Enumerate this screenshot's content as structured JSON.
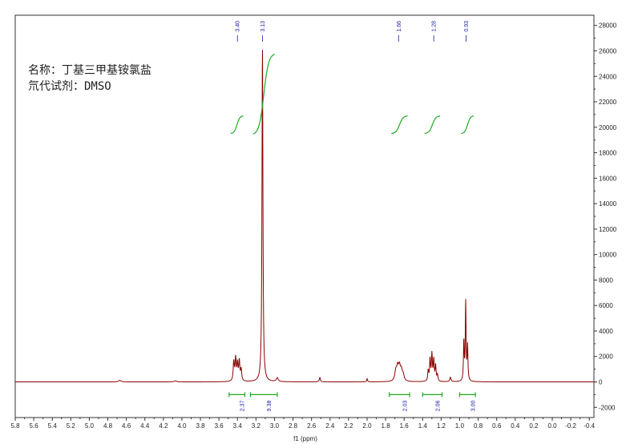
{
  "chart_data": {
    "type": "line",
    "title": "",
    "xlabel": "f1 (ppm)",
    "ylabel": "",
    "xlim": [
      5.8,
      -0.45
    ],
    "ylim": [
      -2800,
      28800
    ],
    "x_ticks": [
      "5.8",
      "5.6",
      "5.4",
      "5.2",
      "5.0",
      "4.8",
      "4.6",
      "4.4",
      "4.2",
      "4.0",
      "3.8",
      "3.6",
      "3.4",
      "3.2",
      "3.0",
      "2.8",
      "2.6",
      "2.4",
      "2.2",
      "2.0",
      "1.8",
      "1.6",
      "1.4",
      "1.2",
      "1.0",
      "0.8",
      "0.6",
      "0.4",
      "0.2",
      "0.0",
      "-0.2",
      "-0.4"
    ],
    "y_ticks": [
      "-2000",
      "0",
      "2000",
      "4000",
      "6000",
      "8000",
      "10000",
      "12000",
      "14000",
      "16000",
      "18000",
      "20000",
      "22000",
      "24000",
      "26000",
      "28000"
    ],
    "line_color": "#8b0000",
    "integral_color": "#22aa22",
    "label_color": "#1a1aa0",
    "peak_labels": [
      "3.40",
      "3.13",
      "1.66",
      "1.28",
      "0.93"
    ],
    "peaks": [
      {
        "ppm": 4.67,
        "intensity": 120,
        "width": 0.015
      },
      {
        "ppm": 4.07,
        "intensity": 80,
        "width": 0.015
      },
      {
        "ppm": 3.44,
        "intensity": 1500,
        "width": 0.007
      },
      {
        "ppm": 3.42,
        "intensity": 1750,
        "width": 0.007
      },
      {
        "ppm": 3.4,
        "intensity": 1300,
        "width": 0.007
      },
      {
        "ppm": 3.38,
        "intensity": 1550,
        "width": 0.007
      },
      {
        "ppm": 3.36,
        "intensity": 900,
        "width": 0.007
      },
      {
        "ppm": 3.13,
        "intensity": 26400,
        "width": 0.006
      },
      {
        "ppm": 2.97,
        "intensity": 300,
        "width": 0.012
      },
      {
        "ppm": 2.51,
        "intensity": 350,
        "width": 0.007
      },
      {
        "ppm": 2.0,
        "intensity": 250,
        "width": 0.005
      },
      {
        "ppm": 1.69,
        "intensity": 750,
        "width": 0.012
      },
      {
        "ppm": 1.67,
        "intensity": 1000,
        "width": 0.012
      },
      {
        "ppm": 1.65,
        "intensity": 1000,
        "width": 0.012
      },
      {
        "ppm": 1.63,
        "intensity": 750,
        "width": 0.012
      },
      {
        "ppm": 1.61,
        "intensity": 450,
        "width": 0.012
      },
      {
        "ppm": 1.34,
        "intensity": 800,
        "width": 0.006
      },
      {
        "ppm": 1.32,
        "intensity": 1700,
        "width": 0.006
      },
      {
        "ppm": 1.3,
        "intensity": 2100,
        "width": 0.006
      },
      {
        "ppm": 1.28,
        "intensity": 1650,
        "width": 0.006
      },
      {
        "ppm": 1.26,
        "intensity": 1200,
        "width": 0.006
      },
      {
        "ppm": 1.24,
        "intensity": 500,
        "width": 0.006
      },
      {
        "ppm": 1.1,
        "intensity": 350,
        "width": 0.008
      },
      {
        "ppm": 0.955,
        "intensity": 3100,
        "width": 0.005
      },
      {
        "ppm": 0.935,
        "intensity": 6200,
        "width": 0.005
      },
      {
        "ppm": 0.915,
        "intensity": 2700,
        "width": 0.005
      }
    ],
    "integrals": [
      {
        "from": 3.49,
        "to": 3.32,
        "value": "2.37"
      },
      {
        "from": 3.26,
        "to": 2.97,
        "value": "9.38"
      },
      {
        "from": 1.76,
        "to": 1.54,
        "value": "2.03"
      },
      {
        "from": 1.4,
        "to": 1.19,
        "value": "2.06"
      },
      {
        "from": 1.0,
        "to": 0.83,
        "value": "3.00"
      }
    ]
  },
  "caption": {
    "line1": "名称：丁基三甲基铵氯盐",
    "line2": "氘代试剂：DMSO"
  }
}
